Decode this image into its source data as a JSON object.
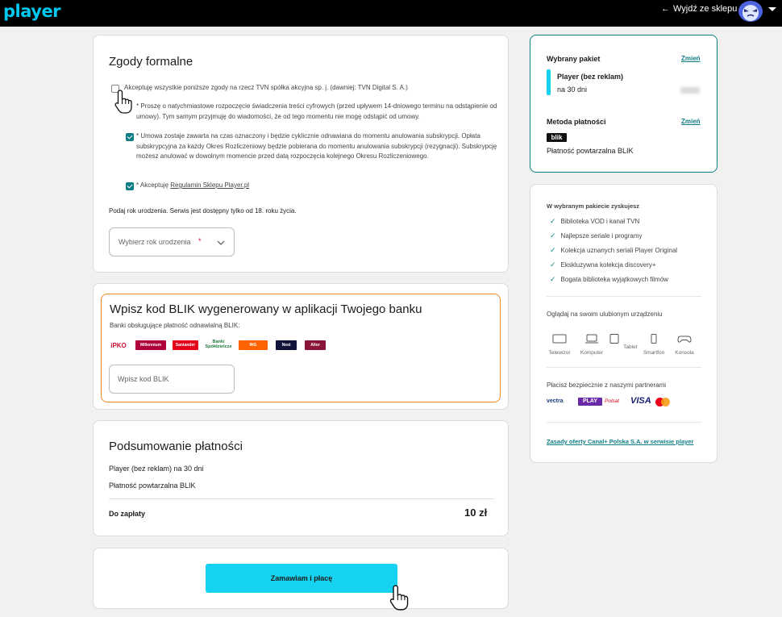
{
  "header": {
    "logo": "player",
    "exit_label": "Wyjdź ze sklepu"
  },
  "consents": {
    "title": "Zgody formalne",
    "accept_all": "Akceptuję wszystkie poniższe zgody na rzecz TVN spółka akcyjna sp. j. (dawniej: TVN Digital S. A.)",
    "item1": "* Proszę o natychmiastowe rozpoczęcie świadczenia treści cyfrowych (przed upływem 14-dniowego terminu na odstąpienie od umowy). Tym samym przyjmuję do wiadomości, że od tego momentu nie mogę odstąpić od umowy.",
    "item2": "* Umowa zostaje zawarta na czas oznaczony i będzie cyklicznie odnawiana do momentu anulowania subskrypcji. Opłata subskrypcyjna za każdy Okres Rozliczeniowy będzie pobierana do momentu anulowania subskrypcji (rezygnacji). Subskrypcję możesz anulować w dowolnym momencie przed datą rozpoczęcia kolejnego Okresu Rozliczeniowego.",
    "item3_prefix": "* Akceptuję ",
    "item3_link": "Regulamin Sklepu Player.pl",
    "birth_note": "Podaj rok urodzenia. Serwis jest dostępny tylko od 18. roku życia.",
    "birth_placeholder": "Wybierz rok urodzenia",
    "birth_required": "*"
  },
  "blik": {
    "title": "Wpisz kod BLIK wygenerowany w aplikacji Twojego banku",
    "banks_label": "Banki obsługujące płatność odnawialną BLIK:",
    "banks": [
      "iPKO",
      "Millennium",
      "Santander",
      "Banki Spółdzielcze",
      "ING",
      "Nest",
      "Alior"
    ],
    "bank_colors": [
      "#c8102e",
      "#b0003a",
      "#e2001a",
      "#1f7a3c",
      "#ff6200",
      "#10123a",
      "#8a1538"
    ],
    "input_placeholder": "Wpisz kod BLIK"
  },
  "summary": {
    "title": "Podsumowanie płatności",
    "line1": "Player (bez reklam) na 30 dni",
    "line2": "Płatność powtarzalna BLIK",
    "total_label": "Do zapłaty",
    "total_value": "10 zł"
  },
  "cta": {
    "label": "Zamawiam i płacę"
  },
  "selected": {
    "title": "Wybrany pakiet",
    "change": "Zmień",
    "package_name": "Player (bez reklam)",
    "package_period": "na 30 dni",
    "method_title": "Metoda płatności",
    "method_change": "Zmień",
    "method_logo": "blik",
    "method_name": "Płatność powtarzalna BLIK"
  },
  "benefits": {
    "title": "W wybranym pakiecie zyskujesz",
    "items": [
      "Biblioteka VOD i kanał TVN",
      "Najlepsze seriale i programy",
      "Kolekcja uznanych seriali Player Original",
      "Ekskluzywna kolekcja discovery+",
      "Bogata biblioteka wyjątkowych filmów"
    ],
    "devices_title": "Oglądaj na swoim ulubionym urządzeniu",
    "devices": [
      "Telewizor",
      "Komputer",
      "Tablet",
      "Smartfon",
      "Konsola"
    ],
    "partners_title": "Płacisz bezpiecznie z naszymi partnerami",
    "partners": [
      "vectra",
      "PLAY",
      "Polsat",
      "VISA"
    ],
    "offer_link": "Zasady oferty Canal+ Polska S.A. w serwisie player"
  },
  "colors": {
    "accent": "#14d2f0",
    "teal": "#0e7d85",
    "blik_border": "#f08a24"
  }
}
